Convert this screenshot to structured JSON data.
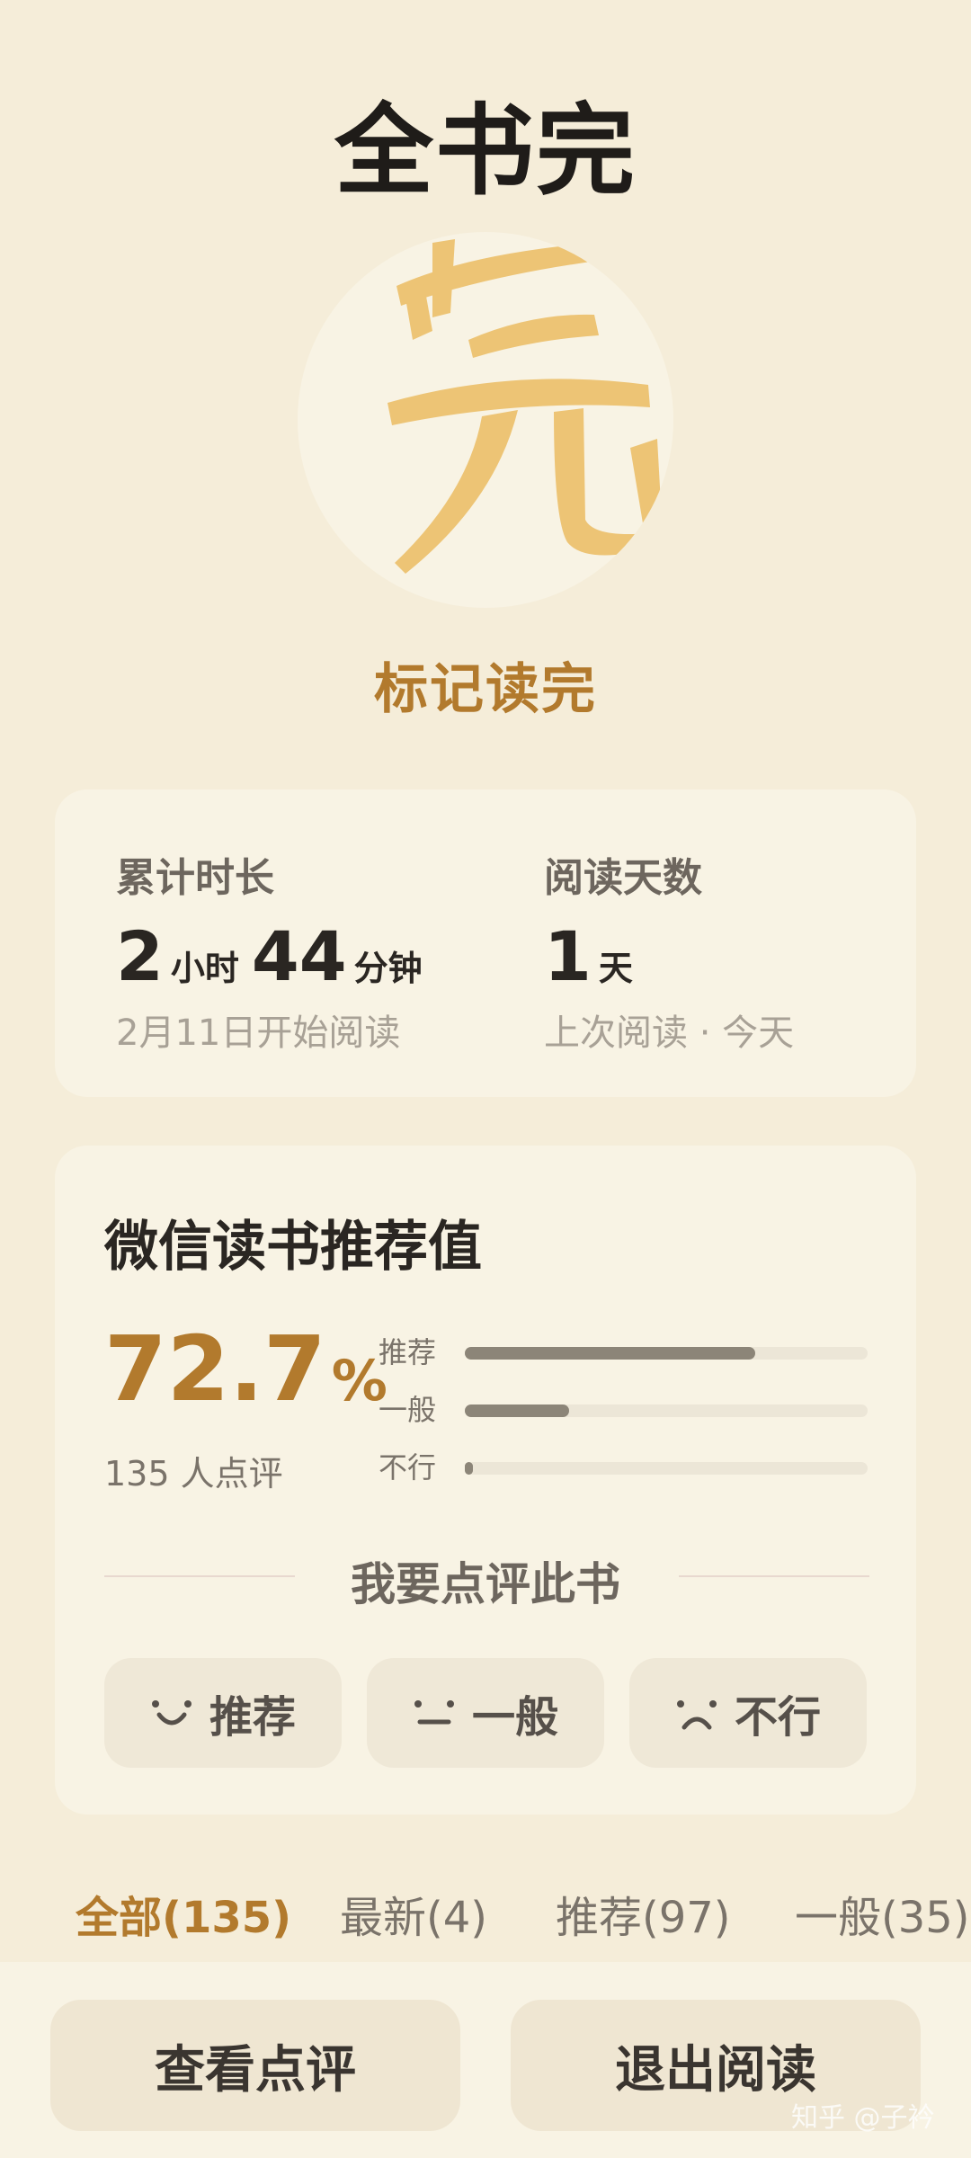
{
  "header": {
    "title": "全书完"
  },
  "finish": {
    "seal_glyph": "完",
    "mark_label": "标记读完"
  },
  "stats": {
    "total_time": {
      "label": "累计时长",
      "hours": "2",
      "hours_unit": "小时",
      "minutes": "44",
      "minutes_unit": "分钟",
      "sub": "2月11日开始阅读"
    },
    "reading_days": {
      "label": "阅读天数",
      "value": "1",
      "unit": "天",
      "sub": "上次阅读 · 今天"
    }
  },
  "recommendation": {
    "title": "微信读书推荐值",
    "percent": "72.7",
    "percent_sign": "%",
    "count_text": "135 人点评",
    "bars": [
      {
        "label": "推荐",
        "fraction": 0.72
      },
      {
        "label": "一般",
        "fraction": 0.26
      },
      {
        "label": "不行",
        "fraction": 0.02
      }
    ],
    "rate_title": "我要点评此书",
    "rate_buttons": [
      {
        "label": "推荐",
        "icon": "smile-face-icon"
      },
      {
        "label": "一般",
        "icon": "neutral-face-icon"
      },
      {
        "label": "不行",
        "icon": "frown-face-icon"
      }
    ]
  },
  "tabs": [
    {
      "label": "全部(135)",
      "active": true
    },
    {
      "label": "最新(4)",
      "active": false
    },
    {
      "label": "推荐(97)",
      "active": false
    },
    {
      "label": "一般(35)",
      "active": false
    }
  ],
  "bottom": {
    "view_reviews": "查看点评",
    "exit_reading": "退出阅读"
  },
  "watermark": "知乎 @子衿",
  "colors": {
    "accent": "#B27A2D",
    "background": "#F5EDD9",
    "card": "#F8F3E4",
    "seal_ink": "#EDC475"
  }
}
